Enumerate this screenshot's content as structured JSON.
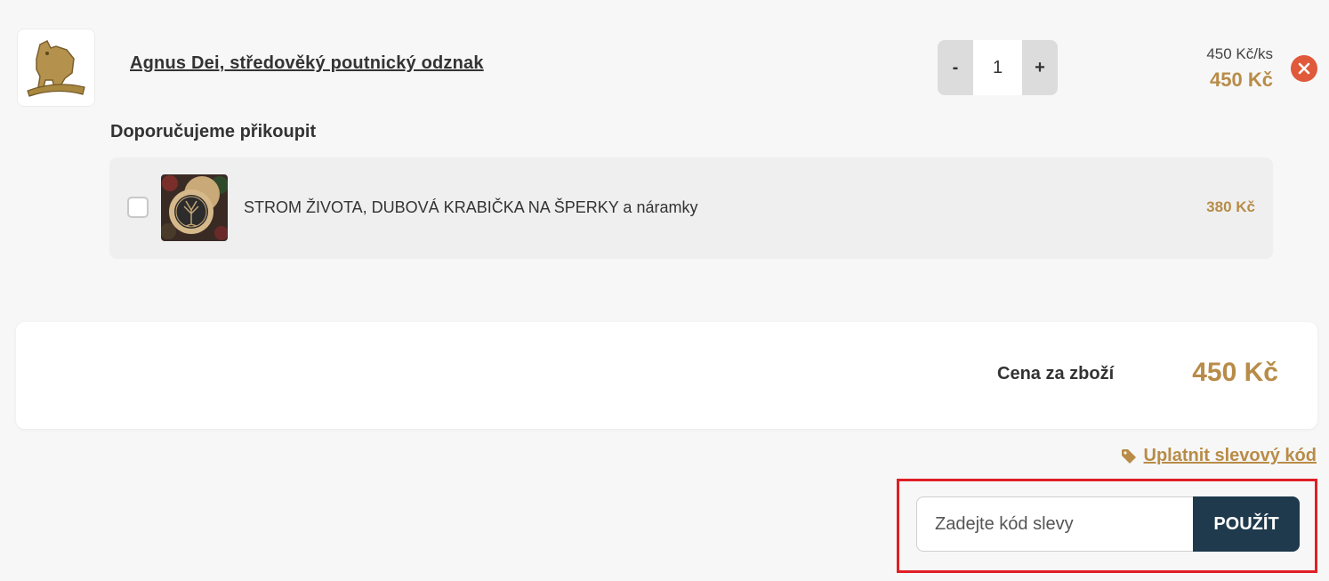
{
  "cart_item": {
    "name": "Agnus Dei, středověký poutnický odznak",
    "quantity": "1",
    "decrease_label": "-",
    "increase_label": "+",
    "unit_price": "450 Kč/ks",
    "total_price": "450 Kč",
    "remove_icon": "close-icon"
  },
  "recommendations": {
    "heading": "Doporučujeme přikoupit",
    "items": [
      {
        "name": "STROM ŽIVOTA, DUBOVÁ KRABIČKA NA ŠPERKY a náramky",
        "price": "380 Kč",
        "checked": false
      }
    ]
  },
  "summary": {
    "label": "Cena za zboží",
    "value": "450 Kč"
  },
  "discount": {
    "link_label": "Uplatnit slevový kód",
    "link_icon": "tag-icon",
    "placeholder": "Zadejte kód slevy",
    "value": "",
    "apply_label": "POUŽÍT"
  },
  "colors": {
    "accent": "#b88c48",
    "button_dark": "#1f3a4d",
    "remove": "#e0593a",
    "highlight": "#e01f26"
  }
}
